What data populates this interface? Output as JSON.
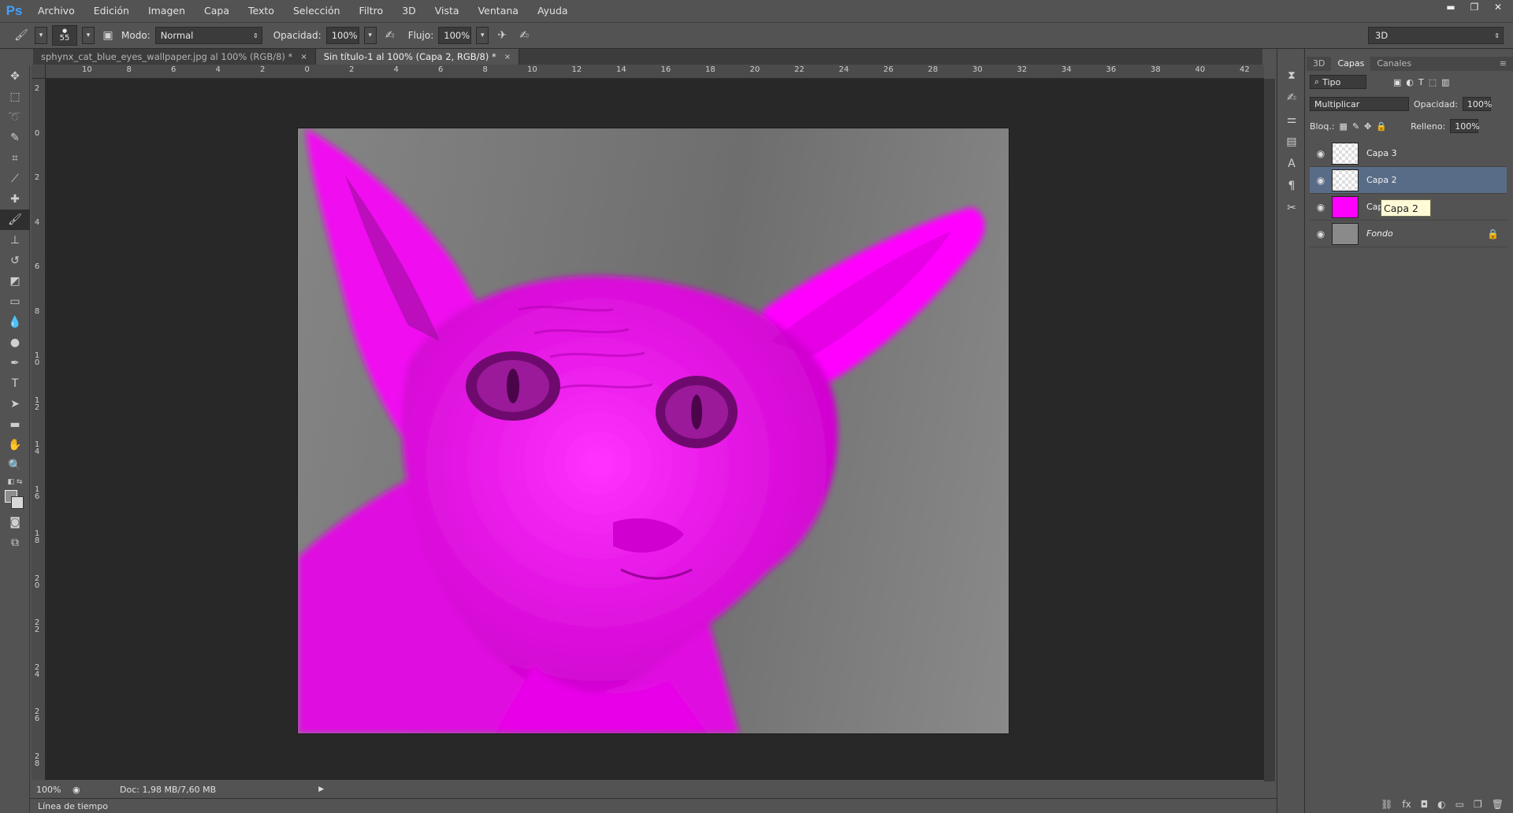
{
  "app": {
    "logo": "Ps"
  },
  "menu": [
    "Archivo",
    "Edición",
    "Imagen",
    "Capa",
    "Texto",
    "Selección",
    "Filtro",
    "3D",
    "Vista",
    "Ventana",
    "Ayuda"
  ],
  "window_controls": {
    "minimize": "▬",
    "restore": "❐",
    "close": "✕"
  },
  "options": {
    "brush_size": "55",
    "mode_label": "Modo:",
    "mode_value": "Normal",
    "opacity_label": "Opacidad:",
    "opacity_value": "100%",
    "flow_label": "Flujo:",
    "flow_value": "100%",
    "workspace": "3D"
  },
  "tabs": [
    {
      "label": "sphynx_cat_blue_eyes_wallpaper.jpg al 100% (RGB/8) *",
      "close": "×"
    },
    {
      "label": "Sin título-1 al 100% (Capa 2, RGB/8) *",
      "close": "×"
    }
  ],
  "ruler_top": [
    "10",
    "8",
    "6",
    "4",
    "2",
    "0",
    "2",
    "4",
    "6",
    "8",
    "10",
    "12",
    "14",
    "16",
    "18",
    "20",
    "22",
    "24",
    "26",
    "28",
    "30",
    "32",
    "34",
    "36",
    "38",
    "40",
    "42"
  ],
  "ruler_left": [
    "2",
    "0",
    "2",
    "4",
    "6",
    "8",
    "10",
    "12",
    "14",
    "16",
    "18",
    "20",
    "22",
    "24",
    "26",
    "28"
  ],
  "status": {
    "zoom": "100%",
    "doc": "Doc: 1,98 MB/7,60 MB",
    "timeline": "Línea de tiempo"
  },
  "layers_panel": {
    "tabs": [
      "3D",
      "Capas",
      "Canales"
    ],
    "filter": "Tipo",
    "blend_mode": "Multiplicar",
    "opacity_label": "Opacidad:",
    "opacity_value": "100%",
    "lock_label": "Bloq.:",
    "fill_label": "Relleno:",
    "fill_value": "100%",
    "layers": [
      {
        "name": "Capa 3",
        "visible": true,
        "selected": false
      },
      {
        "name": "Capa 2",
        "visible": true,
        "selected": true
      },
      {
        "name": "Cap",
        "visible": true,
        "selected": false
      },
      {
        "name": "Fondo",
        "visible": true,
        "selected": false,
        "locked": true
      }
    ],
    "tooltip": "Capa 2"
  },
  "colors": {
    "accent_magenta": "#ff00ff",
    "selection": "#596c87",
    "canvas_bg": "#282828"
  }
}
